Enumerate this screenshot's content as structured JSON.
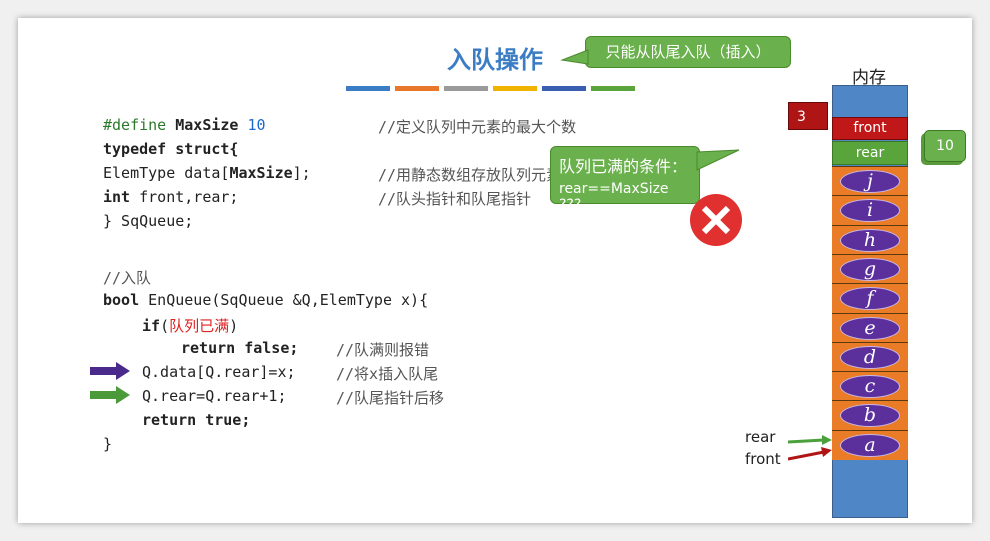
{
  "title": "入队操作",
  "title_callout": "只能从队尾入队（插入）",
  "accent_bars": [
    "#3b7dc4",
    "#e8772b",
    "#9a9a9a",
    "#f0b400",
    "#3a5fb0",
    "#5aa43c"
  ],
  "code_struct": [
    {
      "a": "#define ",
      "b": "MaxSize ",
      "c": "10",
      "comment": "//定义队列中元素的最大个数"
    },
    {
      "a": "typedef struct{",
      "comment": ""
    },
    {
      "a": "ElemType data[",
      "b": "MaxSize",
      "c": "];",
      "comment": "//用静态数组存放队列元素"
    },
    {
      "a": "int ",
      "b": "front,rear;",
      "comment": "//队头指针和队尾指针"
    },
    {
      "a": "} SqQueue;",
      "comment": ""
    }
  ],
  "code_func": {
    "comment_enqueue": "//入队",
    "sig_kw": "bool ",
    "sig_rest": "EnQueue(SqQueue &Q,ElemType x){",
    "if_kw": "if",
    "if_open": "(",
    "if_cond": "队列已满",
    "if_close": ")",
    "return_false": "return false;",
    "return_false_cmt": "//队满则报错",
    "line_data": "Q.data[Q.rear]=x;",
    "line_data_cmt": "//将x插入队尾",
    "line_rear": "Q.rear=Q.rear+1;",
    "line_rear_cmt": "//队尾指针后移",
    "return_true": "return true;",
    "close": "}"
  },
  "full_callout": {
    "line1": "队列已满的条件：",
    "line2": "rear==MaxSize ???"
  },
  "memory": {
    "title": "内存",
    "front_label": "front",
    "rear_label": "rear",
    "front_value": "3",
    "rear_value": "10",
    "cells": [
      "j",
      "i",
      "h",
      "g",
      "f",
      "e",
      "d",
      "c",
      "b",
      "a"
    ]
  },
  "pointer_labels": {
    "rear": "rear",
    "front": "front"
  }
}
